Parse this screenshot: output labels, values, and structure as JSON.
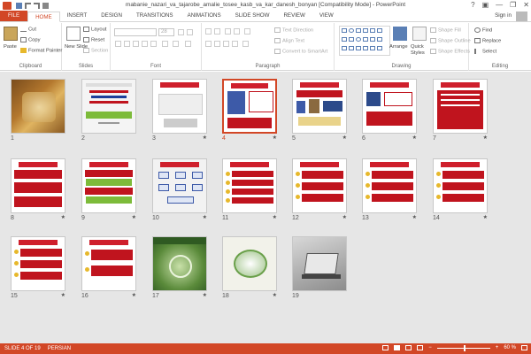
{
  "window": {
    "title": "mabanie_nazari_va_tajarobe_amalie_tosee_kasb_va_kar_danesh_bonyan [Compatibility Mode] - PowerPoint",
    "controls": [
      "?",
      "▣",
      "—",
      "❐",
      "✕"
    ]
  },
  "tabs": [
    "FILE",
    "HOME",
    "INSERT",
    "DESIGN",
    "TRANSITIONS",
    "ANIMATIONS",
    "SLIDE SHOW",
    "REVIEW",
    "VIEW"
  ],
  "active_tab": "HOME",
  "signin": "Sign in",
  "ribbon": {
    "clipboard": {
      "label": "Clipboard",
      "paste": "Paste",
      "cut": "Cut",
      "copy": "Copy",
      "format_painter": "Format Painter"
    },
    "slides": {
      "label": "Slides",
      "new_slide": "New Slide",
      "layout": "Layout",
      "reset": "Reset",
      "section": "Section"
    },
    "font": {
      "label": "Font",
      "size": "28"
    },
    "paragraph": {
      "label": "Paragraph",
      "text_direction": "Text Direction",
      "align_text": "Align Text",
      "smartart": "Convert to SmartArt"
    },
    "drawing": {
      "label": "Drawing",
      "arrange": "Arrange",
      "quick_styles": "Quick Styles",
      "shape_fill": "Shape Fill",
      "shape_outline": "Shape Outline",
      "shape_effects": "Shape Effects"
    },
    "editing": {
      "label": "Editing",
      "find": "Find",
      "replace": "Replace",
      "select": "Select"
    }
  },
  "slides": [
    {
      "num": "1",
      "star": false
    },
    {
      "num": "2",
      "star": false
    },
    {
      "num": "3",
      "star": true
    },
    {
      "num": "4",
      "star": true
    },
    {
      "num": "5",
      "star": true
    },
    {
      "num": "6",
      "star": true
    },
    {
      "num": "7",
      "star": true
    },
    {
      "num": "8",
      "star": true
    },
    {
      "num": "9",
      "star": true
    },
    {
      "num": "10",
      "star": true
    },
    {
      "num": "11",
      "star": true
    },
    {
      "num": "12",
      "star": true
    },
    {
      "num": "13",
      "star": true
    },
    {
      "num": "14",
      "star": true
    },
    {
      "num": "15",
      "star": true
    },
    {
      "num": "16",
      "star": true
    },
    {
      "num": "17",
      "star": true
    },
    {
      "num": "18",
      "star": true
    },
    {
      "num": "19",
      "star": false
    }
  ],
  "selected_slide": "4",
  "star_glyph": "★",
  "status": {
    "slide": "SLIDE 4 OF 19",
    "language": "PERSIAN",
    "zoom": "60 %"
  }
}
